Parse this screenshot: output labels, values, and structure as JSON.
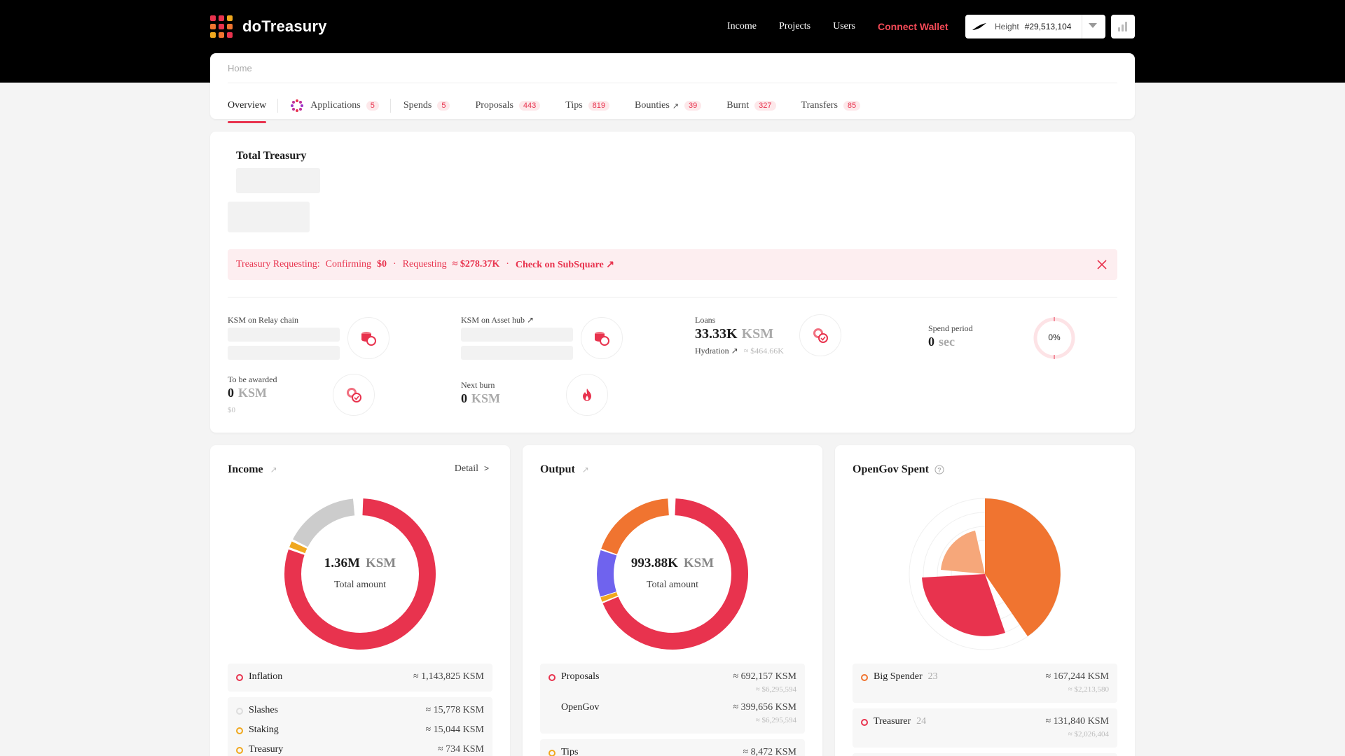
{
  "app": {
    "name": "doTreasury"
  },
  "nav": {
    "income": "Income",
    "projects": "Projects",
    "users": "Users",
    "connect": "Connect Wallet"
  },
  "height": {
    "label": "Height",
    "value": "#29,513,104"
  },
  "breadcrumb": "Home",
  "tabs": [
    {
      "label": "Overview"
    },
    {
      "label": "Applications",
      "count": "5"
    },
    {
      "label": "Spends",
      "count": "5"
    },
    {
      "label": "Proposals",
      "count": "443"
    },
    {
      "label": "Tips",
      "count": "819"
    },
    {
      "label": "Bounties",
      "count": "39",
      "arrow": "↗"
    },
    {
      "label": "Burnt",
      "count": "327"
    },
    {
      "label": "Transfers",
      "count": "85"
    }
  ],
  "treasury": {
    "title": "Total Treasury",
    "alert": {
      "label": "Treasury Requesting:",
      "confirming_label": "Confirming",
      "confirming_value": "$0",
      "requesting_label": "Requesting",
      "requesting_value": "≈ $278.37K",
      "link": "Check on SubSquare ↗",
      "sep": "·"
    },
    "relay": {
      "label": "KSM on Relay chain"
    },
    "assethub": {
      "label": "KSM on Asset hub ↗"
    },
    "loans": {
      "label": "Loans",
      "value": "33.33K",
      "unit": "KSM",
      "sub_label": "Hydration ↗",
      "sub_value": "≈ $464.66K"
    },
    "spend_period": {
      "label": "Spend period",
      "value": "0",
      "unit": "sec",
      "progress_text": "0%",
      "progress": 0
    },
    "to_be_awarded": {
      "label": "To be awarded",
      "value": "0",
      "unit": "KSM",
      "usd": "$0"
    },
    "next_burn": {
      "label": "Next burn",
      "value": "0",
      "unit": "KSM"
    }
  },
  "income": {
    "title": "Income",
    "arrow": "↗",
    "detail": "Detail",
    "total": "1.36M",
    "unit": "KSM",
    "total_label": "Total amount",
    "rows": [
      {
        "name": "Inflation",
        "amount": "≈ 1,143,825 KSM",
        "color": "#e8334e"
      },
      {
        "name": "Slashes",
        "amount": "≈ 15,778 KSM",
        "color": "#dddddd"
      },
      {
        "name": "Staking",
        "amount": "≈ 15,044 KSM",
        "color": "#f0a81f"
      },
      {
        "name": "Treasury",
        "amount": "≈ 734 KSM",
        "color": "#f0a81f"
      }
    ]
  },
  "output": {
    "title": "Output",
    "arrow": "↗",
    "total": "993.88K",
    "unit": "KSM",
    "total_label": "Total amount",
    "rows": [
      {
        "name": "Proposals",
        "amount": "≈ 692,157 KSM",
        "usd": "≈ $6,295,594",
        "color": "#e8334e"
      },
      {
        "name": "OpenGov",
        "amount": "≈ 399,656 KSM",
        "usd": "≈ $6,295,594"
      },
      {
        "name": "Tips",
        "amount": "≈ 8,472 KSM",
        "color": "#f0a81f"
      }
    ]
  },
  "opengov": {
    "title": "OpenGov Spent",
    "rows": [
      {
        "name": "Big Spender",
        "count": "23",
        "amount": "≈ 167,244 KSM",
        "usd": "≈ $2,213,580",
        "color": "#f07430"
      },
      {
        "name": "Treasurer",
        "count": "24",
        "amount": "≈ 131,840 KSM",
        "usd": "≈ $2,026,404",
        "color": "#e8334e"
      }
    ]
  },
  "colors": {
    "accent": "#e8334e",
    "orange": "#f07430",
    "purple": "#6f63ee",
    "yellow": "#f0a81f",
    "grey": "#cccccc",
    "peach": "#f6a77a"
  }
}
